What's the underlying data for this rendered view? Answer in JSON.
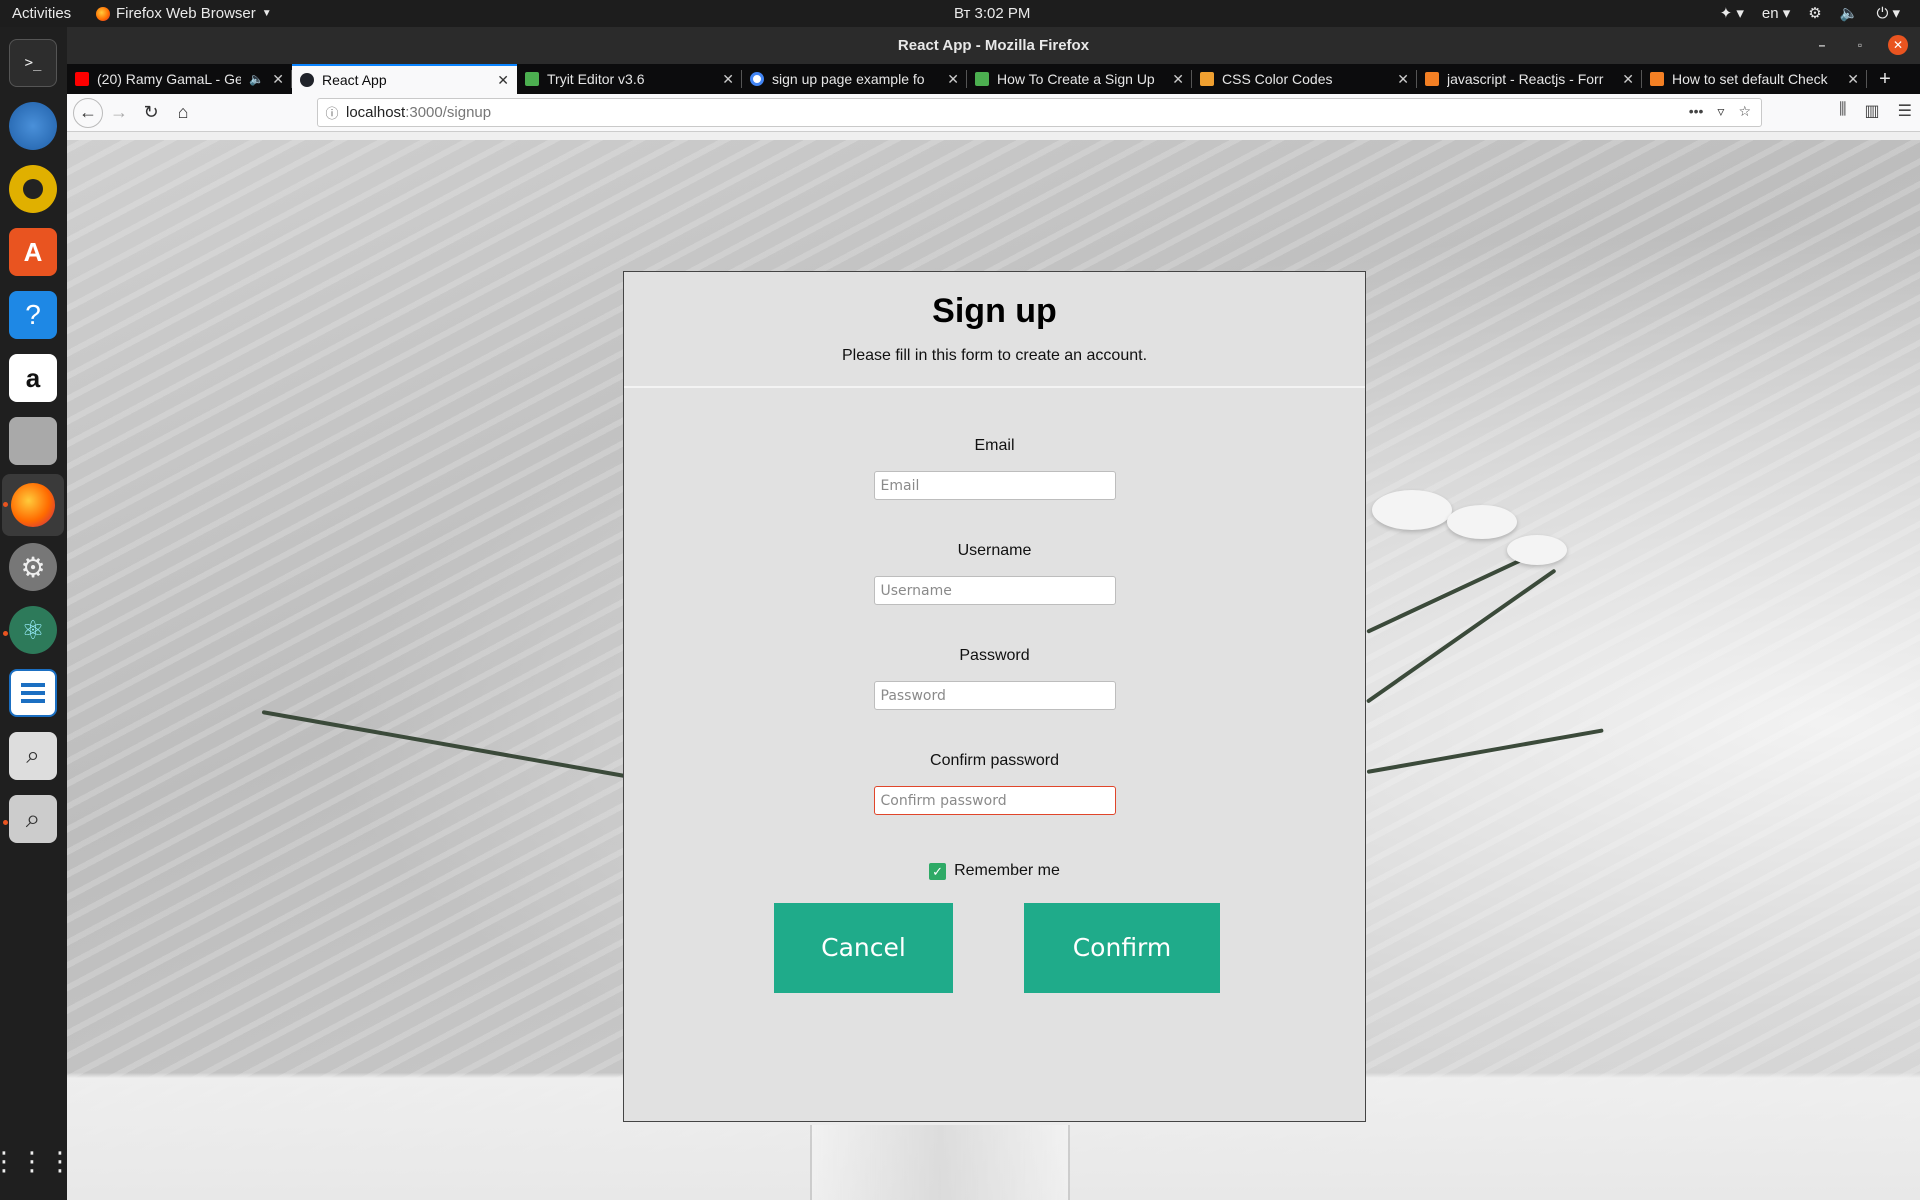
{
  "topbar": {
    "activities": "Activities",
    "app_name": "Firefox Web Browser",
    "clock": "Вт  3:02 PM",
    "lang": "en"
  },
  "dock": {
    "items": [
      "terminal-icon",
      "thunderbird-icon",
      "rhythmbox-icon",
      "software-center-icon",
      "help-icon",
      "amazon-icon",
      "files-icon",
      "firefox-icon",
      "settings-icon",
      "atom-icon",
      "writer-icon",
      "screenshot-icon",
      "search-icon"
    ],
    "show_apps_icon": "grid-icon"
  },
  "window": {
    "title": "React App - Mozilla Firefox"
  },
  "tabs": [
    {
      "title": "(20) Ramy GamaL - Ge",
      "color": "#ff0000"
    },
    {
      "title": "React App",
      "color": "#20232a"
    },
    {
      "title": "Tryit Editor v3.6",
      "color": "#4caf50"
    },
    {
      "title": "sign up page example fo",
      "color": "#4285f4"
    },
    {
      "title": "How To Create a Sign Up",
      "color": "#4caf50"
    },
    {
      "title": "CSS Color Codes",
      "color": "#f0a030"
    },
    {
      "title": "javascript - Reactjs - Forr",
      "color": "#f48024"
    },
    {
      "title": "How to set default Check",
      "color": "#f48024"
    }
  ],
  "url": {
    "host": "localhost",
    "path": ":3000/signup"
  },
  "form": {
    "title": "Sign up",
    "subtitle": "Please fill in this form to create an account.",
    "email_label": "Email",
    "email_placeholder": "Email",
    "username_label": "Username",
    "username_placeholder": "Username",
    "password_label": "Password",
    "password_placeholder": "Password",
    "confirm_label": "Confirm password",
    "confirm_placeholder": "Confirm password",
    "remember_label": "Remember me",
    "remember_checked": true,
    "cancel_label": "Cancel",
    "confirm_button_label": "Confirm",
    "accent_color": "#1fab8a"
  }
}
